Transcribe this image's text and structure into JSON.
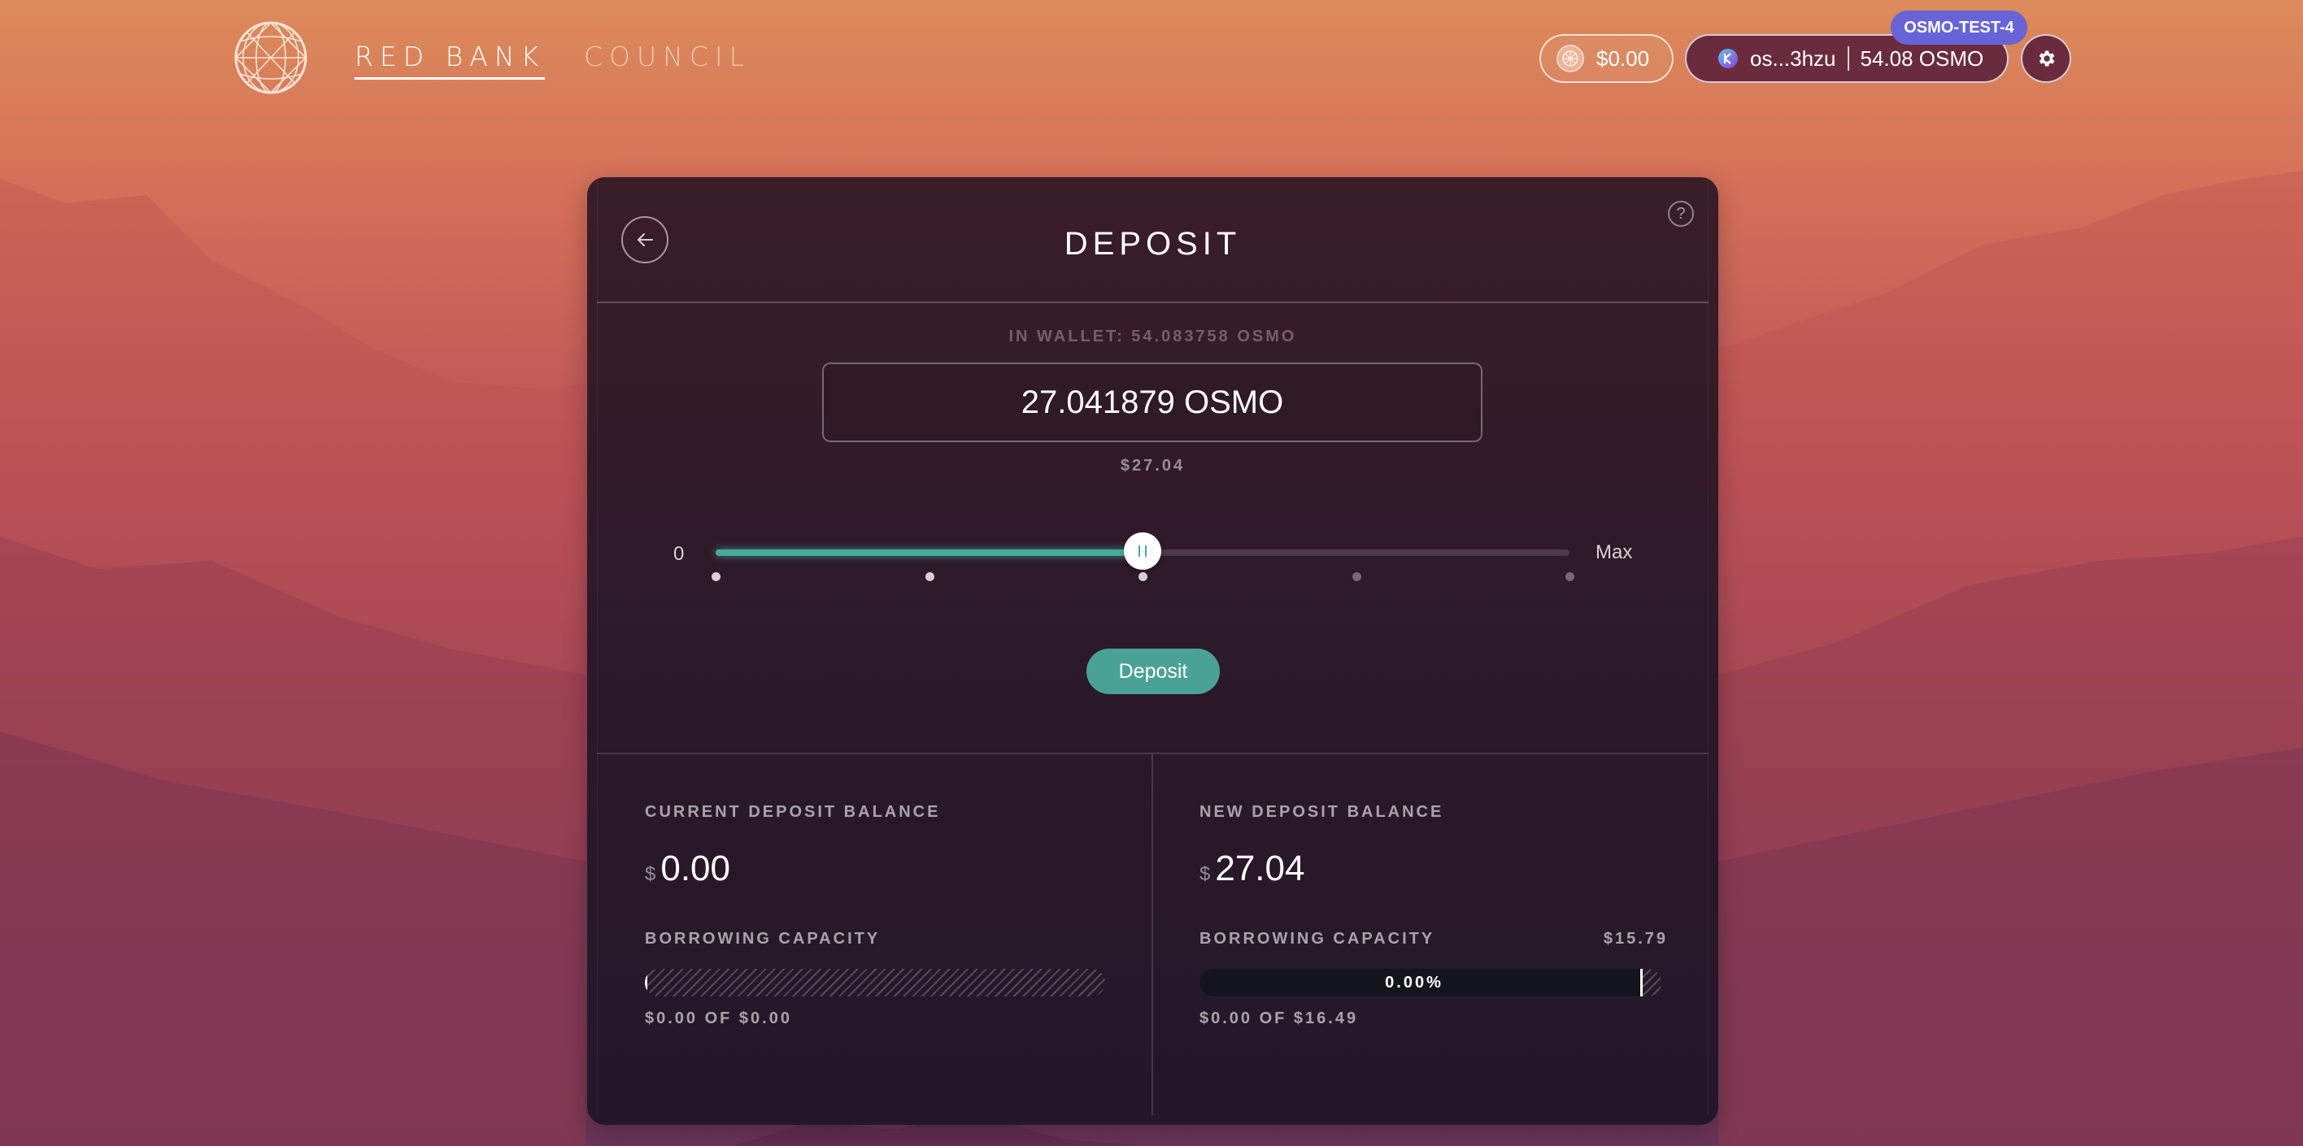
{
  "header": {
    "nav": [
      {
        "label": "RED BANK",
        "active": true
      },
      {
        "label": "COUNCIL",
        "active": false
      }
    ],
    "balance": "$0.00",
    "wallet_address": "os...3hzu",
    "wallet_balance": "54.08 OSMO",
    "chain_badge": "OSMO-TEST-4",
    "icons": {
      "logo": "globe-logo-icon",
      "balance": "coin-icon",
      "wallet": "keplr-wallet-icon",
      "settings": "gear-icon"
    }
  },
  "card": {
    "title": "DEPOSIT",
    "help_label": "?",
    "in_wallet": "IN WALLET: 54.083758 OSMO",
    "amount": "27.041879 OSMO",
    "usd_value": "$27.04",
    "slider": {
      "min_label": "0",
      "max_label": "Max",
      "value_fraction": 0.5,
      "step_marks": [
        0,
        0.25,
        0.5,
        0.75,
        1
      ]
    },
    "deposit_button": "Deposit",
    "current": {
      "label": "CURRENT DEPOSIT BALANCE",
      "currency": "$",
      "value": "0.00",
      "capacity_label": "BORROWING CAPACITY",
      "capacity_fraction": 0,
      "capacity_sub": "$0.00 OF $0.00"
    },
    "new": {
      "label": "NEW DEPOSIT BALANCE",
      "currency": "$",
      "value": "27.04",
      "capacity_label": "BORROWING CAPACITY",
      "capacity_limit": "$15.79",
      "capacity_percent": "0.00%",
      "capacity_fraction": 0,
      "limit_fraction": 0.958,
      "capacity_sub": "$0.00 OF $16.49"
    }
  },
  "colors": {
    "accent": "#4aa296",
    "wallet_pill": "#6b2b3f",
    "chain_badge": "#6664d6"
  }
}
